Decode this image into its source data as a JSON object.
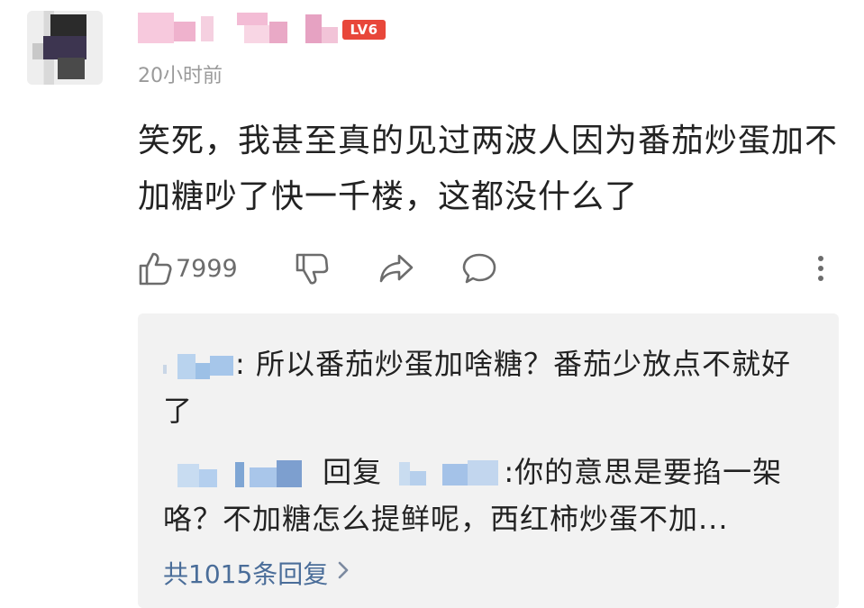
{
  "comment": {
    "level_badge": "LV6",
    "timestamp": "20小时前",
    "text": "笑死，我甚至真的见过两波人因为番茄炒蛋加不加糖吵了快一千楼，这都没什么了",
    "like_count": "7999",
    "icons": [
      "thumbs-up-icon",
      "thumbs-down-icon",
      "share-icon",
      "comment-icon",
      "more-vertical-icon"
    ]
  },
  "replies": {
    "items": [
      {
        "sep": ":",
        "text": "所以番茄炒蛋加啥糖？番茄少放点不就好了"
      },
      {
        "reply_word": "回复",
        "sep": ":",
        "text": "你的意思是要掐一架咯？不加糖怎么提鲜呢，西红柿炒蛋不加..."
      }
    ],
    "view_more": "共1015条回复",
    "view_more_icon": "chevron-right-icon"
  },
  "colors": {
    "level_badge": "#e8473a",
    "link": "#4a6d99",
    "reply_background": "#f2f2f2"
  }
}
